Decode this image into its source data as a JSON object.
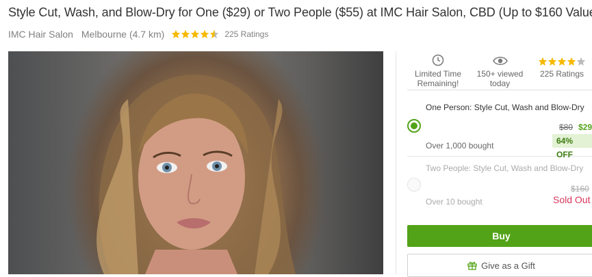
{
  "deal": {
    "title": "Style Cut, Wash, and Blow-Dry for One ($29) or Two People ($55) at IMC Hair Salon, CBD (Up to $160 Value)",
    "merchant": "IMC Hair Salon",
    "location": "Melbourne (4.7 km)",
    "rating_stars": 4.5,
    "ratings_label": "225 Ratings"
  },
  "features": [
    {
      "icon": "clock-icon",
      "line1": "Limited Time",
      "line2": "Remaining!"
    },
    {
      "icon": "eye-icon",
      "line1": "150+ viewed",
      "line2": "today"
    },
    {
      "icon": "stars-icon",
      "line1": "225 Ratings",
      "line2": ""
    }
  ],
  "options": [
    {
      "title": "One Person: Style Cut, Wash and Blow-Dry",
      "original_price": "$80",
      "price": "$29",
      "discount": "64% OFF",
      "bought": "Over 1,000 bought",
      "selected": true,
      "status": ""
    },
    {
      "title": "Two People: Style Cut, Wash and Blow-Dry",
      "original_price": "$160",
      "price": "",
      "discount": "",
      "bought": "Over 10 bought",
      "selected": false,
      "status": "Sold Out"
    }
  ],
  "actions": {
    "buy_label": "Buy",
    "gift_label": "Give as a Gift"
  },
  "colors": {
    "accent": "#53a318",
    "star": "#f6b900",
    "sold_out": "#d6365b"
  }
}
